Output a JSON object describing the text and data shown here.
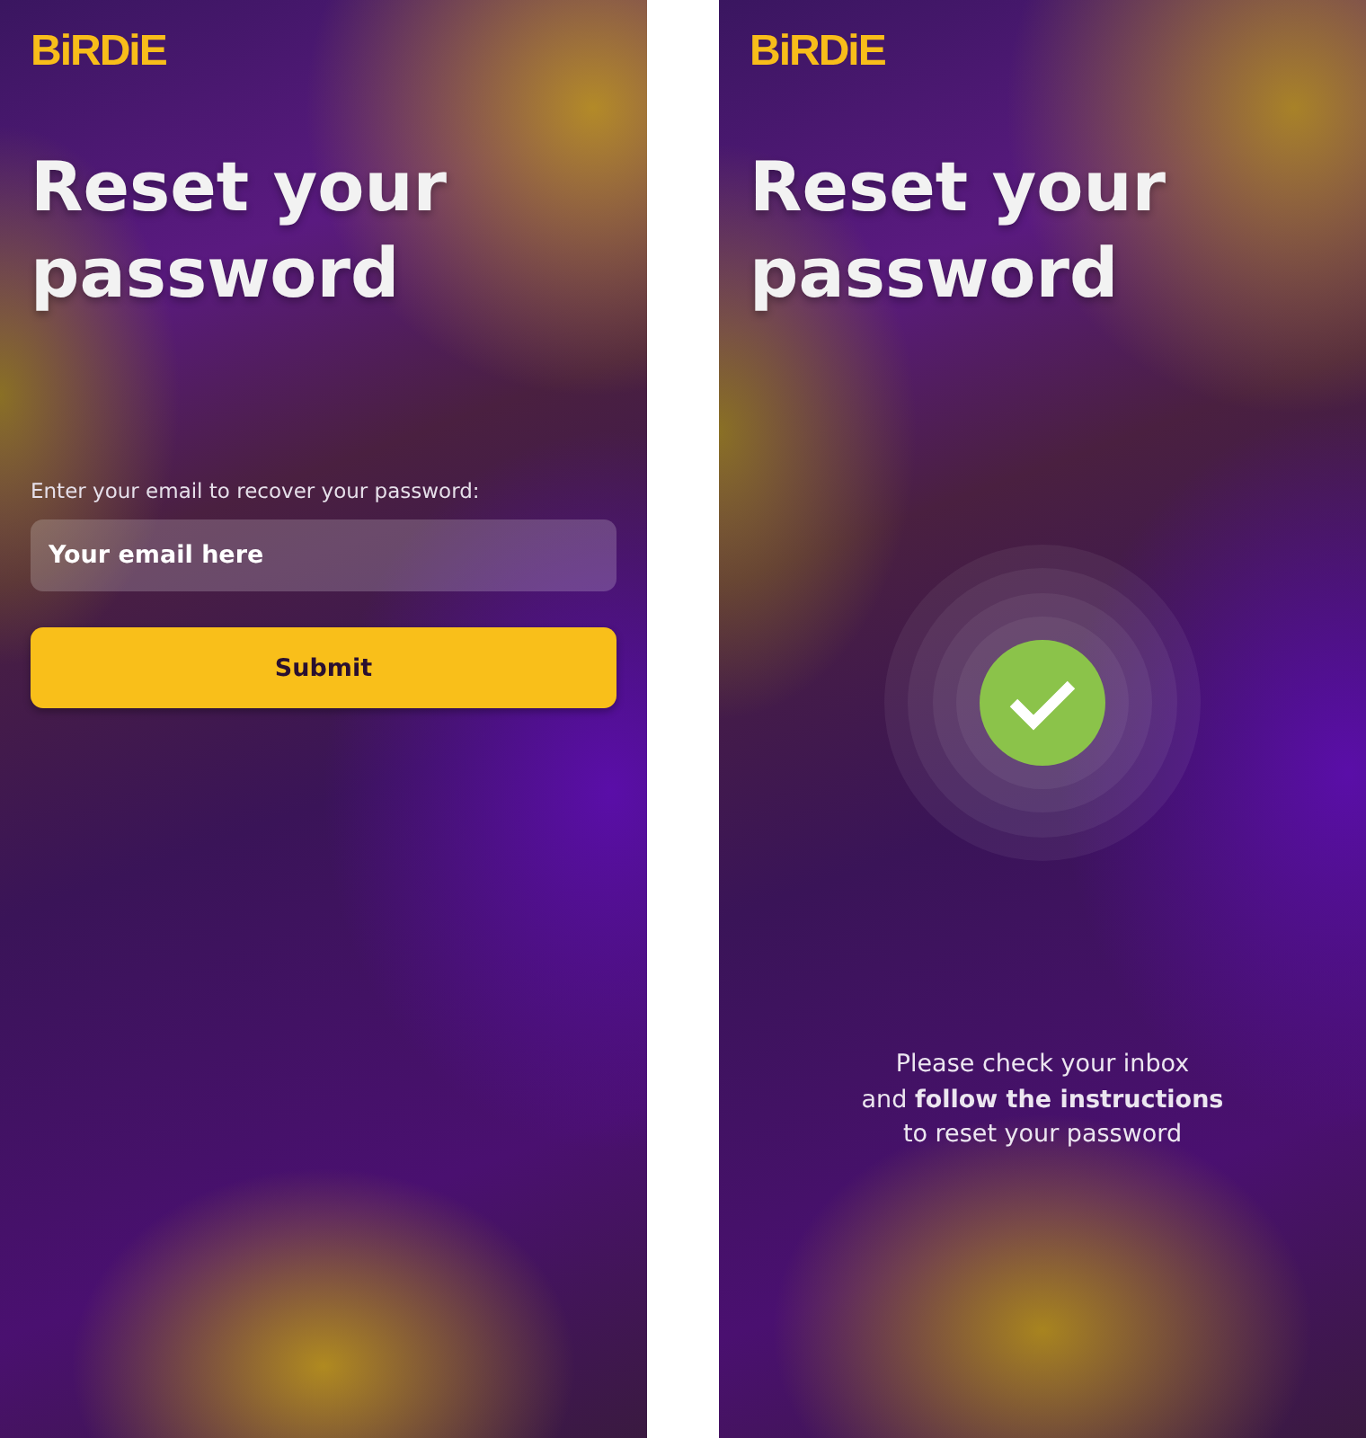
{
  "screens": [
    {
      "kind": "form",
      "logo": "BiRDiE",
      "title": "Reset your password",
      "field": {
        "label": "Enter your email to recover your password:",
        "placeholder": "Your email here"
      },
      "button": "Submit"
    },
    {
      "kind": "success",
      "logo": "BiRDiE",
      "title": "Reset your password",
      "message": "Please check your inbox\nand **follow the instructions**\nto reset your password"
    }
  ]
}
